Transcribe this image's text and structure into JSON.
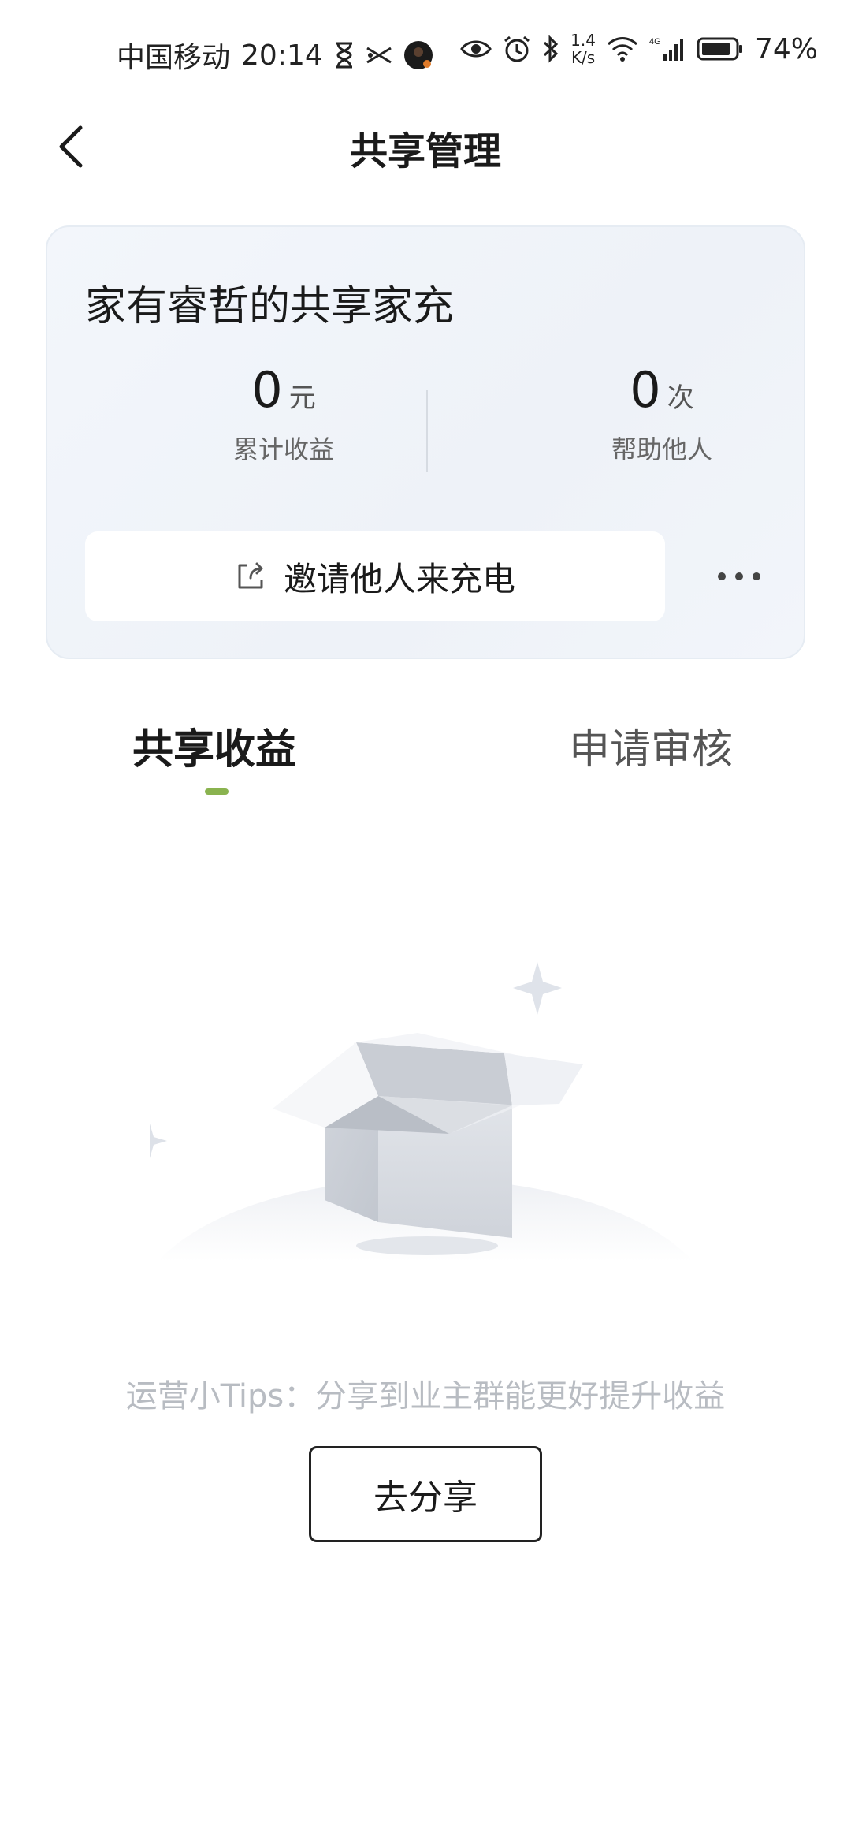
{
  "status_bar": {
    "carrier": "中国移动",
    "time": "20:14",
    "net_speed_value": "1.4",
    "net_speed_unit": "K/s",
    "network_type": "4G",
    "battery_percent": "74%",
    "icons": [
      "hourglass-icon",
      "scissors-icon",
      "avatar-icon",
      "eye-icon",
      "alarm-icon",
      "bluetooth-icon",
      "wifi-icon",
      "signal-icon",
      "battery-icon"
    ]
  },
  "nav": {
    "title": "共享管理",
    "back_icon": "chevron-left-icon"
  },
  "card": {
    "title": "家有睿哲的共享家充",
    "earnings": {
      "value": "0",
      "unit": "元",
      "label": "累计收益"
    },
    "helps": {
      "value": "0",
      "unit": "次",
      "label": "帮助他人"
    },
    "invite_button": {
      "label": "邀请他人来充电",
      "icon": "share-icon"
    },
    "more_icon": "more-horizontal-icon"
  },
  "tabs": [
    {
      "label": "共享收益",
      "active": true
    },
    {
      "label": "申请审核",
      "active": false
    }
  ],
  "empty_state": {
    "illustration": "empty-box-illustration",
    "tips": "运营小Tips：分享到业主群能更好提升收益",
    "share_button": "去分享"
  },
  "colors": {
    "accent": "#8ab34f",
    "card_bg": "#eef2f8",
    "tips_text": "#b8bcc2"
  }
}
